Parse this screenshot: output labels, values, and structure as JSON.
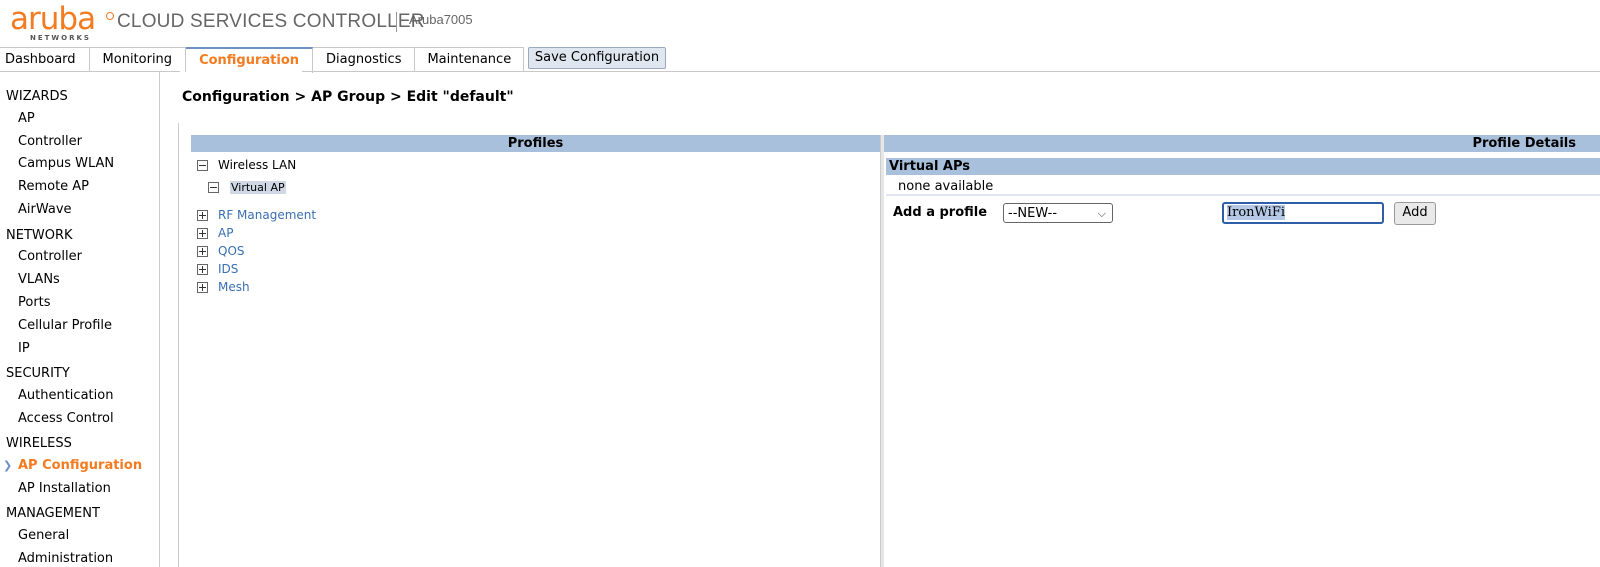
{
  "header": {
    "logo_text": "aruba",
    "logo_sub": "NETWORKS",
    "app_title": "CLOUD SERVICES CONTROLLER",
    "device_name": "Aruba7005"
  },
  "tabs": [
    {
      "label": "Dashboard",
      "active": false
    },
    {
      "label": "Monitoring",
      "active": false
    },
    {
      "label": "Configuration",
      "active": true
    },
    {
      "label": "Diagnostics",
      "active": false
    },
    {
      "label": "Maintenance",
      "active": false
    }
  ],
  "save_button": "Save Configuration",
  "sidebar": {
    "wizards": {
      "title": "WIZARDS",
      "items": [
        "AP",
        "Controller",
        "Campus WLAN",
        "Remote AP",
        "AirWave"
      ]
    },
    "network": {
      "title": "NETWORK",
      "items": [
        "Controller",
        "VLANs",
        "Ports",
        "Cellular Profile",
        "IP"
      ]
    },
    "security": {
      "title": "SECURITY",
      "items": [
        "Authentication",
        "Access Control"
      ]
    },
    "wireless": {
      "title": "WIRELESS",
      "items": [
        "AP Configuration",
        "AP Installation"
      ],
      "active": "AP Configuration"
    },
    "management": {
      "title": "MANAGEMENT",
      "items": [
        "General",
        "Administration"
      ]
    }
  },
  "breadcrumb": "Configuration > AP Group > Edit \"default\"",
  "profiles": {
    "header": "Profiles",
    "tree": {
      "wireless_lan": "Wireless LAN",
      "virtual_ap": "Virtual AP",
      "rf_management": "RF Management",
      "ap": "AP",
      "qos": "QOS",
      "ids": "IDS",
      "mesh": "Mesh"
    }
  },
  "details": {
    "header": "Profile Details",
    "virtual_aps_title": "Virtual APs",
    "none_text": "none available",
    "add_label": "Add a profile",
    "select_value": "--NEW--",
    "name_value": "IronWiFi",
    "add_button": "Add"
  },
  "colors": {
    "accent": "#f47b20",
    "header_bar": "#a8c0dc",
    "link": "#3a6fb0"
  }
}
